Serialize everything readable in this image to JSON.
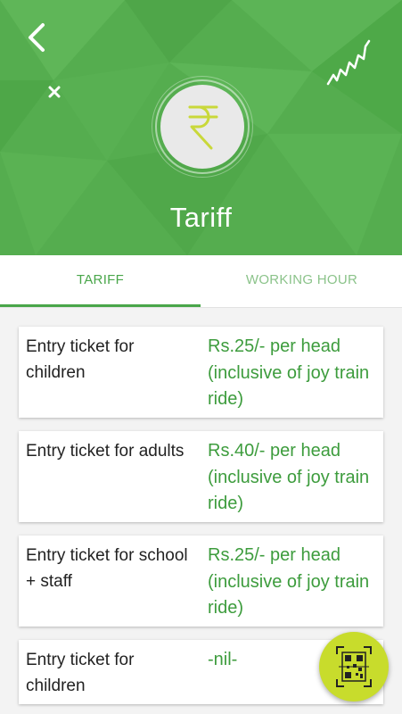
{
  "header": {
    "title": "Tariff",
    "currency_symbol": "₹",
    "background_color": "#55ad4f",
    "icons": [
      "back-arrow-icon",
      "close-icon",
      "squiggle-icon",
      "rupee-icon"
    ]
  },
  "tabs": [
    {
      "label": "TARIFF",
      "active": true
    },
    {
      "label": "WORKING HOUR",
      "active": false
    }
  ],
  "tariffs": [
    {
      "label": "Entry ticket for children",
      "value": "Rs.25/- per head (inclusive of joy train ride)"
    },
    {
      "label": "Entry ticket for adults",
      "value": "Rs.40/- per head (inclusive of joy train ride)"
    },
    {
      "label": "Entry ticket for school + staff",
      "value": "Rs.25/- per head (inclusive of joy train ride)"
    },
    {
      "label": "Entry ticket for children",
      "value": "-nil-"
    }
  ],
  "fab": {
    "icon": "qr-scan-icon",
    "color": "#c8dc2c"
  },
  "colors": {
    "accent": "#49a64a",
    "value_text": "#3d9c3d",
    "tab_inactive": "#8bc38a"
  }
}
